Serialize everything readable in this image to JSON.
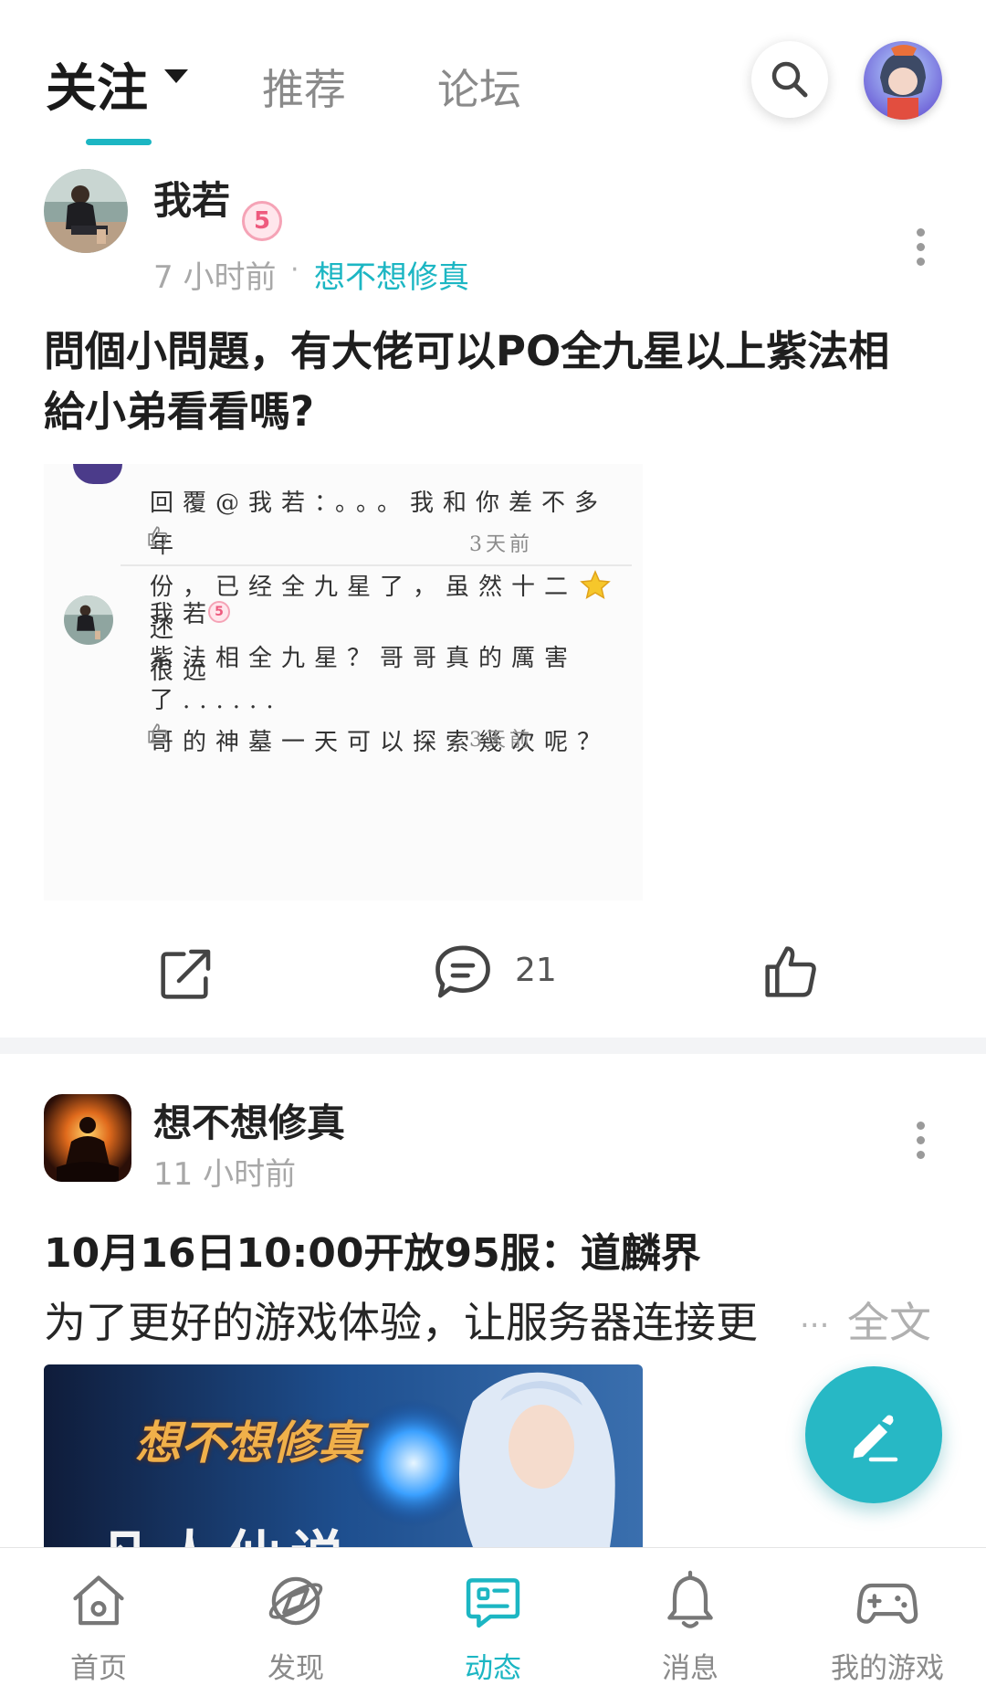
{
  "header": {
    "tabs": [
      {
        "label": "关注",
        "active": true
      },
      {
        "label": "推荐",
        "active": false
      },
      {
        "label": "论坛",
        "active": false
      }
    ],
    "accent_color": "#1cb6c3"
  },
  "post1": {
    "username": "我若",
    "level": "5",
    "time": "7 小时前",
    "dot": "·",
    "game": "想不想修真",
    "title_line1": "問個小問題，有大佬可以PO全九星以上紫法相",
    "title_line2": "給小弟看看嗎?",
    "image": {
      "comment1_line1": "回覆@我若：。。。我和你差不多年",
      "comment1_line2": "份，已经全九星了，虽然十二",
      "comment1_line2_end": "还",
      "comment1_line3": "很远",
      "comment1_time": "3天前",
      "comment2_user": "我若",
      "comment2_line1": "紫法相全九星？哥哥真的厲害了......",
      "comment2_line2": "哥的神墓一天可以探索幾次呢？",
      "comment2_time": "3天前"
    },
    "comment_count": "21"
  },
  "post2": {
    "author": "想不想修真",
    "time": "11 小时前",
    "title": "10月16日10:00开放95服：道麟界",
    "body": "为了更好的游戏体验，让服务器连接更",
    "ellipsis": "...",
    "fulltext_label": "全文",
    "banner_logo": "想不想修真",
    "banner_caption": "凡人仙说"
  },
  "bottom_nav": [
    {
      "label": "首页",
      "icon": "home-icon",
      "active": false
    },
    {
      "label": "发现",
      "icon": "discover-icon",
      "active": false
    },
    {
      "label": "动态",
      "icon": "feed-icon",
      "active": true
    },
    {
      "label": "消息",
      "icon": "bell-icon",
      "active": false
    },
    {
      "label": "我的游戏",
      "icon": "gamepad-icon",
      "active": false
    }
  ]
}
